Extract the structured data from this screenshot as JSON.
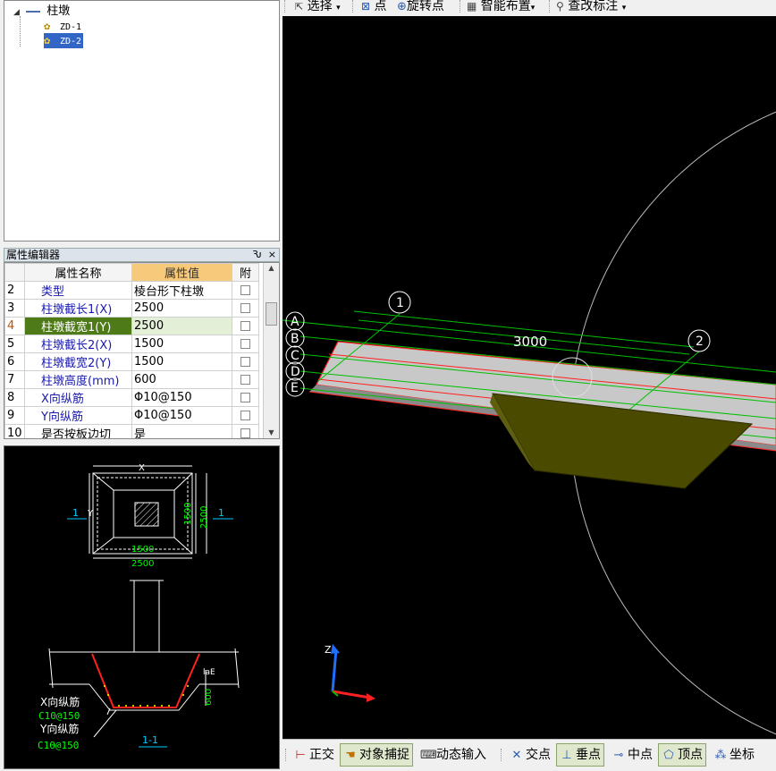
{
  "tree": {
    "root_label": "柱墩",
    "items": [
      {
        "label": "ZD-1",
        "selected": false
      },
      {
        "label": "ZD-2",
        "selected": true
      }
    ]
  },
  "property_editor": {
    "title": "属性编辑器",
    "pin_symbol": "Ԅ",
    "close_symbol": "×",
    "headers": {
      "name": "属性名称",
      "value": "属性值",
      "attach": "附"
    },
    "rows": [
      {
        "num": "2",
        "name": "类型",
        "value": "棱台形下柱墩"
      },
      {
        "num": "3",
        "name": "柱墩截长1(X)",
        "value": "2500"
      },
      {
        "num": "4",
        "name": "柱墩截宽1(Y)",
        "value": "2500"
      },
      {
        "num": "5",
        "name": "柱墩截长2(X)",
        "value": "1500"
      },
      {
        "num": "6",
        "name": "柱墩截宽2(Y)",
        "value": "1500"
      },
      {
        "num": "7",
        "name": "柱墩高度(mm)",
        "value": "600"
      },
      {
        "num": "8",
        "name": "X向纵筋",
        "value": "Φ10@150"
      },
      {
        "num": "9",
        "name": "Y向纵筋",
        "value": "Φ10@150"
      },
      {
        "num": "10",
        "name": "是否按板边切",
        "value": "是"
      }
    ],
    "active_row": "4"
  },
  "preview": {
    "x_label": "X",
    "y_label": "Y",
    "dim_1500": "1500",
    "dim_2500": "2500",
    "section_mark": "1",
    "lae": "laE",
    "height_600": "600",
    "x_rebar_label": "X向纵筋",
    "x_rebar_spec": "C10@150",
    "y_rebar_label": "Y向纵筋",
    "y_rebar_spec": "C10@150",
    "section_title": "1-1"
  },
  "toolbar": {
    "select": "选择",
    "point": "点",
    "rotate_point": "旋转点",
    "smart_layout": "智能布置",
    "edit_label": "查改标注"
  },
  "viewport": {
    "axis_1": "1",
    "axis_2": "2",
    "axis_rows": [
      "A",
      "B",
      "C",
      "D",
      "E"
    ],
    "dimension": "3000",
    "axis_z": "Z"
  },
  "statusbar": {
    "ortho": "正交",
    "snap": "对象捕捉",
    "dynamic_input": "动态输入",
    "intersection": "交点",
    "perpendicular": "垂点",
    "midpoint": "中点",
    "vertex": "顶点",
    "coordinate": "坐标"
  },
  "colors": {
    "selection_blue": "#3166c7",
    "active_row_green": "#4e7a18",
    "value_header_orange": "#f7c97a",
    "pier_olive": "#4a4a00",
    "grid_green": "#00c000",
    "red_edge": "#ff2020"
  }
}
